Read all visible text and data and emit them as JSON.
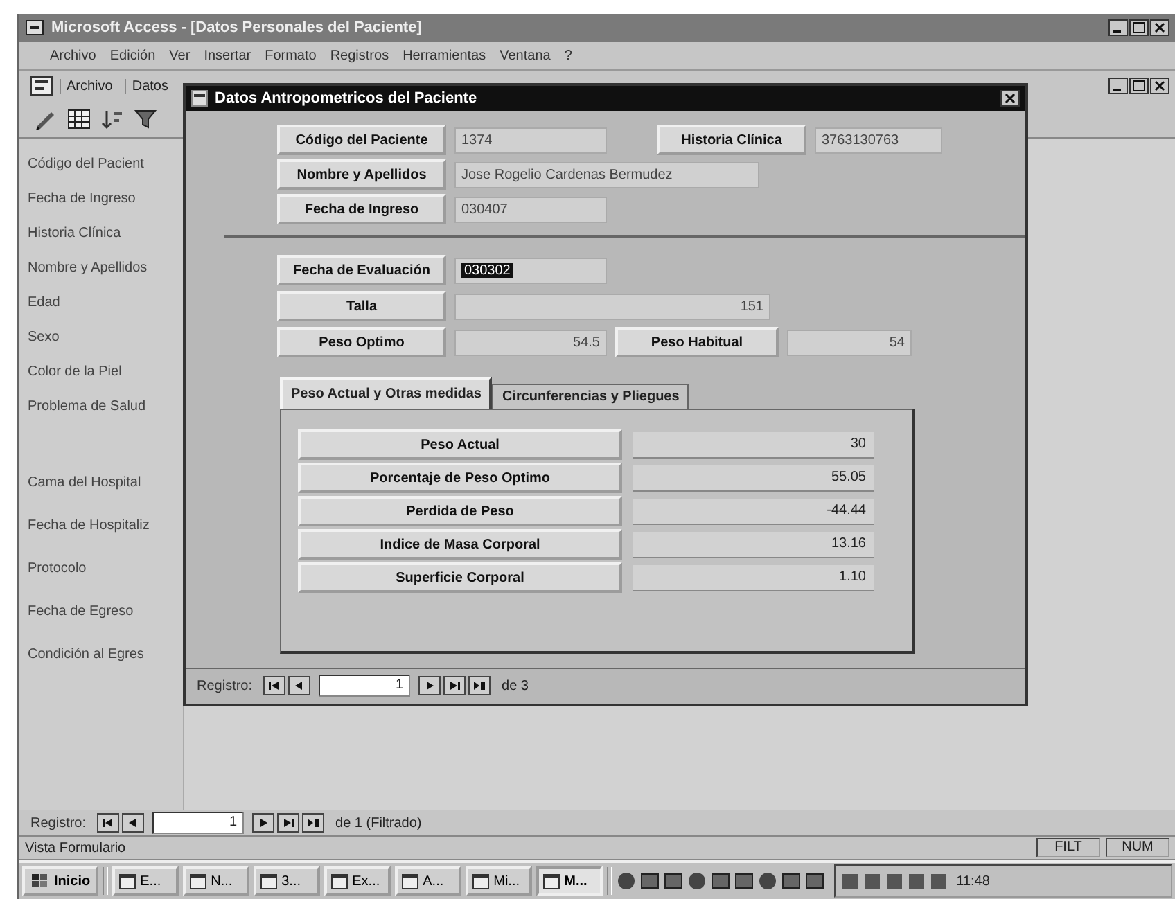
{
  "app": {
    "title": "Microsoft Access - [Datos Personales del Paciente]",
    "menu": [
      "Archivo",
      "Edición",
      "Ver",
      "Insertar",
      "Formato",
      "Registros",
      "Herramientas",
      "Ventana",
      "?"
    ],
    "child_bar": [
      "Archivo",
      "Datos"
    ],
    "form_labels": [
      "Código del Pacient",
      "Fecha de Ingreso",
      "Historia Clínica",
      "Nombre y Apellidos",
      "Edad",
      "Sexo",
      "Color de la Piel",
      "Problema de Salud",
      "Cama del Hospital",
      "Fecha de Hospitaliz",
      "Protocolo",
      "Fecha de Egreso",
      "Condición al Egres"
    ],
    "navigator": {
      "label": "Registro:",
      "current": "1",
      "total": "de 1 (Filtrado)"
    },
    "status_bar": {
      "message": "Vista Formulario",
      "indicators": [
        "FILT",
        "NUM"
      ]
    }
  },
  "dialog": {
    "title": "Datos Antropometricos del Paciente",
    "header_rows": [
      [
        {
          "label": "Código del Paciente",
          "value": "1374"
        },
        {
          "label": "Historia Clínica",
          "value": "3763130763"
        }
      ],
      [
        {
          "label": "Nombre y Apellidos",
          "value": "Jose Rogelio Cardenas Bermudez"
        }
      ],
      [
        {
          "label": "Fecha de Ingreso",
          "value": "030407"
        }
      ]
    ],
    "evaluation_rows": [
      [
        {
          "label": "Fecha de Evaluación",
          "value": "030302",
          "selected": true
        }
      ],
      [
        {
          "label": "Talla",
          "value": "151",
          "selected": false
        }
      ],
      [
        {
          "label": "Peso Optimo",
          "value": "54.5",
          "selected": false
        },
        {
          "label": "Peso Habitual",
          "value": "54",
          "selected": false
        }
      ]
    ],
    "tabs": [
      {
        "label": "Peso Actual y Otras medidas",
        "selected": true
      },
      {
        "label": "Circunferencias y Pliegues",
        "selected": false
      }
    ],
    "measures": [
      {
        "label": "Peso Actual",
        "value": "30"
      },
      {
        "label": "Porcentaje de Peso Optimo",
        "value": "55.05"
      },
      {
        "label": "Perdida de Peso",
        "value": "-44.44"
      },
      {
        "label": "Indice de Masa Corporal",
        "value": "13.16"
      },
      {
        "label": "Superficie Corporal",
        "value": "1.10"
      }
    ],
    "navigator": {
      "label": "Registro:",
      "current": "1",
      "total": "de 3"
    }
  },
  "taskbar": {
    "start": "Inicio",
    "tasks": [
      {
        "label": "E...",
        "selected": false
      },
      {
        "label": "N...",
        "selected": false
      },
      {
        "label": "3...",
        "selected": false
      },
      {
        "label": "Ex...",
        "selected": false
      },
      {
        "label": "A...",
        "selected": false
      },
      {
        "label": "Mi...",
        "selected": false
      },
      {
        "label": "M...",
        "selected": true
      }
    ],
    "clock": "11:48"
  }
}
